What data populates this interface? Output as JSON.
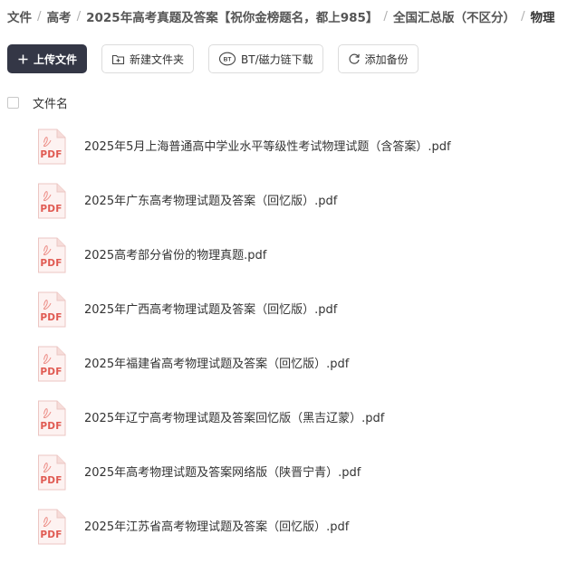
{
  "breadcrumb": {
    "items": [
      "文件",
      "高考",
      "2025年高考真题及答案【祝你金榜题名，都上985】",
      "全国汇总版（不区分）",
      "物理"
    ],
    "separator": "/"
  },
  "toolbar": {
    "upload_label": "上传文件",
    "new_folder_label": "新建文件夹",
    "bt_download_label": "BT/磁力链下载",
    "add_backup_label": "添加备份"
  },
  "table": {
    "column_name": "文件名"
  },
  "file_icon": {
    "label": "PDF",
    "color": "#e05a52"
  },
  "files": [
    "2025年5月上海普通高中学业水平等级性考试物理试题（含答案）.pdf",
    "2025年广东高考物理试题及答案（回忆版）.pdf",
    "2025高考部分省份的物理真题.pdf",
    "2025年广西高考物理试题及答案（回忆版）.pdf",
    "2025年福建省高考物理试题及答案（回忆版）.pdf",
    "2025年辽宁高考物理试题及答案回忆版（黑吉辽蒙）.pdf",
    "2025年高考物理试题及答案网络版（陕晋宁青）.pdf",
    "2025年江苏省高考物理试题及答案（回忆版）.pdf"
  ]
}
